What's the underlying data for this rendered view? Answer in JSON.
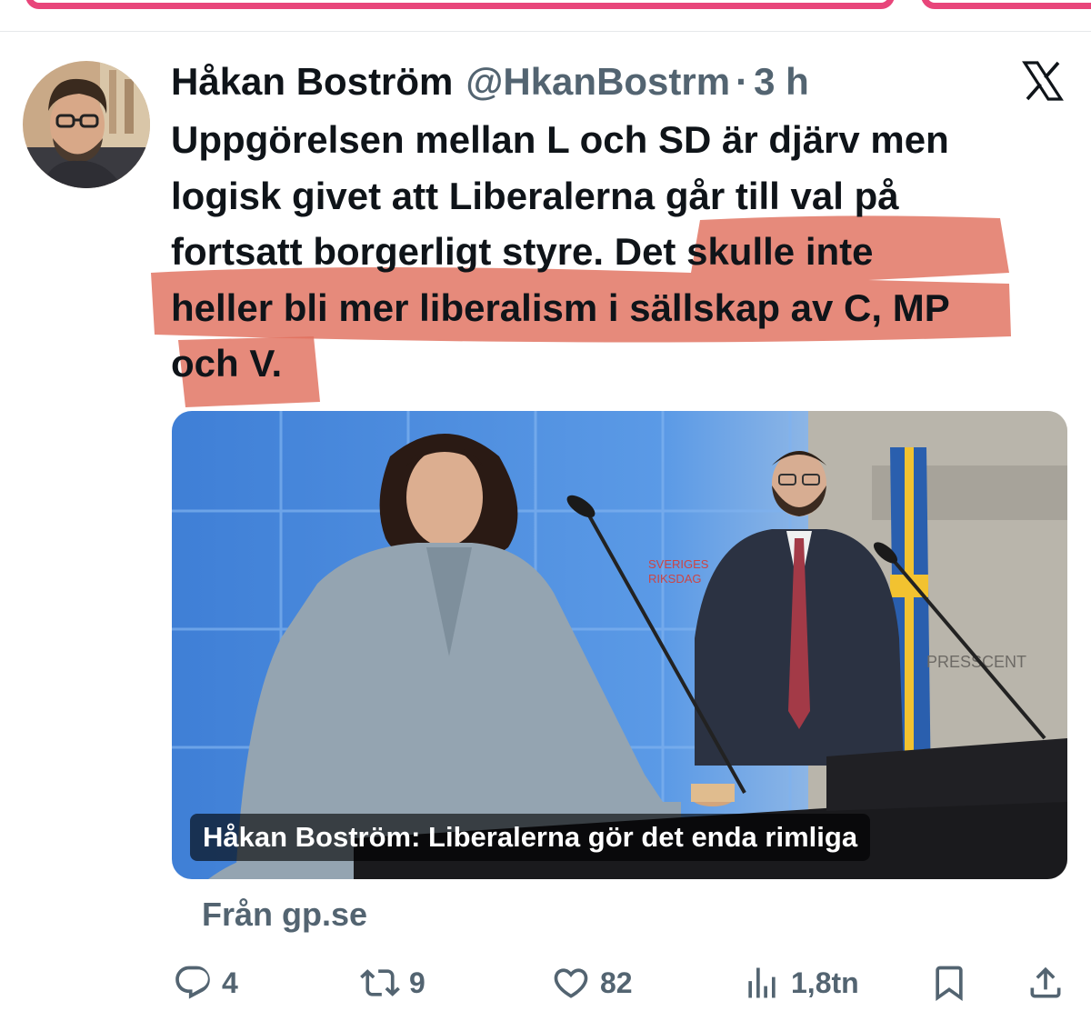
{
  "tweet": {
    "author_name": "Håkan Boström",
    "handle": "@HkanBostrm",
    "separator": "·",
    "time": "3 h",
    "text_lines": [
      "Uppgörelsen mellan L och SD är djärv men",
      "logisk givet att Liberalerna går till val på",
      "fortsatt borgerligt styre. Det skulle inte",
      "heller bli mer liberalism i sällskap av C, MP",
      "och V."
    ],
    "highlight_color": "#e0705e"
  },
  "media": {
    "caption": "Håkan Boström: Liberalerna gör det enda rimliga",
    "backdrop_text_1": "SVERIGES",
    "backdrop_text_2": "RIKSDAG",
    "backdrop_text_3": "PRESSCENT"
  },
  "source": "Från gp.se",
  "actions": {
    "replies": "4",
    "retweets": "9",
    "likes": "82",
    "views": "1,8tn"
  },
  "colors": {
    "accent_pink": "#e8457a",
    "muted": "#536471",
    "text": "#0f1419"
  }
}
